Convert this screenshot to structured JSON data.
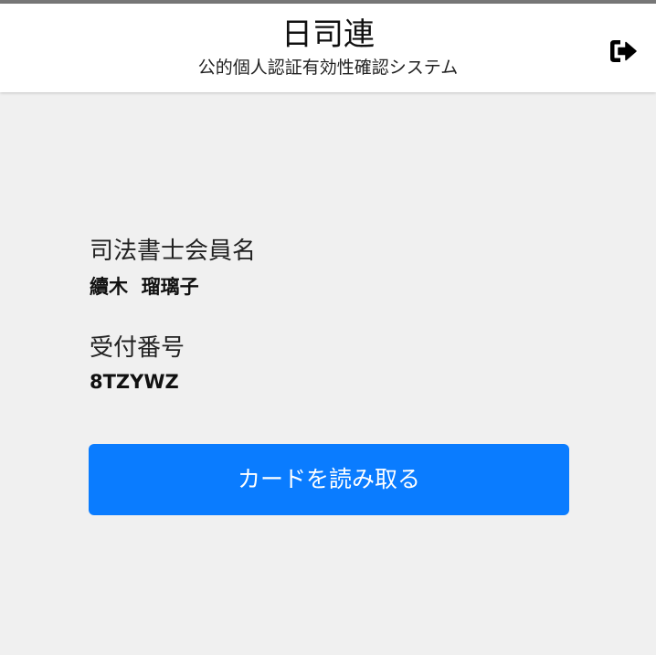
{
  "header": {
    "title": "日司連",
    "subtitle": "公的個人認証有効性確認システム",
    "logout_icon": "sign-out-icon"
  },
  "member": {
    "label": "司法書士会員名",
    "name": "續木  瑠璃子"
  },
  "receipt": {
    "label": "受付番号",
    "number": "8TZYWZ"
  },
  "action": {
    "read_card_label": "カードを読み取る"
  },
  "colors": {
    "primary_button": "#0a7cff",
    "background": "#f0f0f0",
    "header_background": "#ffffff"
  }
}
